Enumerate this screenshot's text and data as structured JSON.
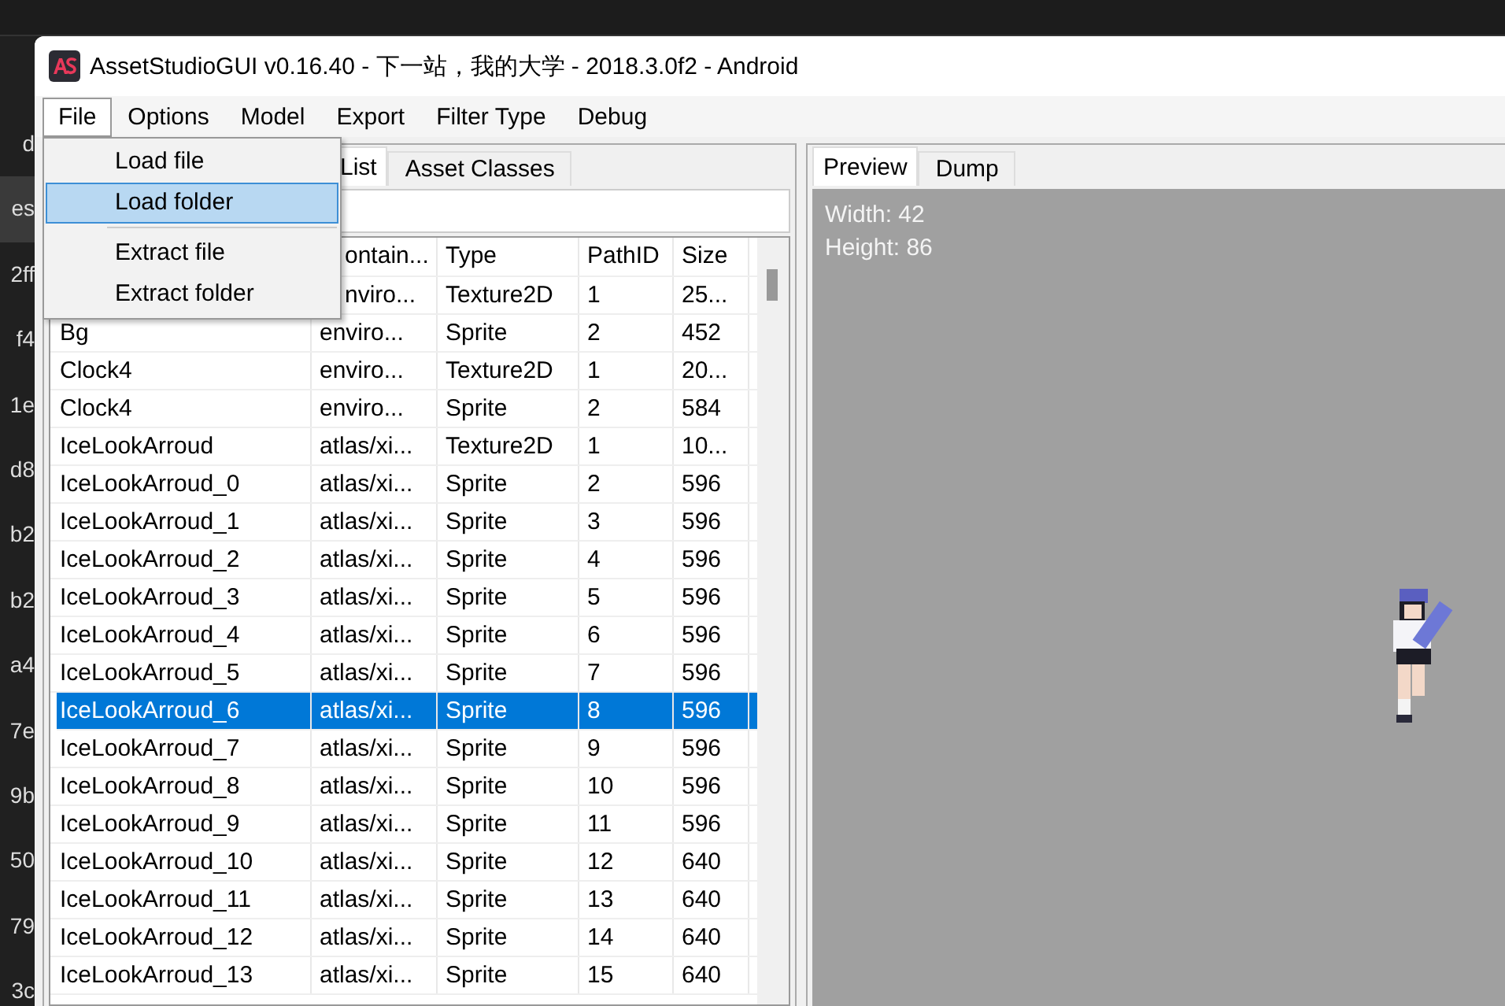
{
  "background_list": [
    {
      "text": "d",
      "selected": false
    },
    {
      "text": "es",
      "selected": true
    },
    {
      "text": "2ff",
      "selected": false
    },
    {
      "text": "f4",
      "selected": false
    },
    {
      "text": "1e",
      "selected": false
    },
    {
      "text": "d8",
      "selected": false
    },
    {
      "text": "b2",
      "selected": false
    },
    {
      "text": "b2",
      "selected": false
    },
    {
      "text": "a4",
      "selected": false
    },
    {
      "text": "7e",
      "selected": false
    },
    {
      "text": "9b",
      "selected": false
    },
    {
      "text": "50",
      "selected": false
    },
    {
      "text": "79",
      "selected": false
    },
    {
      "text": "3c",
      "selected": false
    }
  ],
  "window": {
    "title": "AssetStudioGUI v0.16.40 - 下一站，我的大学 - 2018.3.0f2 - Android"
  },
  "menu_bar": [
    {
      "label": "File",
      "selected": true
    },
    {
      "label": "Options",
      "selected": false
    },
    {
      "label": "Model",
      "selected": false
    },
    {
      "label": "Export",
      "selected": false
    },
    {
      "label": "Filter Type",
      "selected": false
    },
    {
      "label": "Debug",
      "selected": false
    }
  ],
  "file_menu": [
    {
      "kind": "item",
      "label": "Load file",
      "selected": false
    },
    {
      "kind": "item",
      "label": "Load folder",
      "selected": true
    },
    {
      "kind": "separator"
    },
    {
      "kind": "item",
      "label": "Extract file",
      "selected": false
    },
    {
      "kind": "item",
      "label": "Extract folder",
      "selected": false
    }
  ],
  "left_tabs": [
    {
      "label": "List",
      "selected": true
    },
    {
      "label": "Asset Classes",
      "selected": false
    }
  ],
  "table": {
    "columns": [
      "ontain...",
      "Type",
      "PathID",
      "Size"
    ],
    "rows": [
      {
        "name": "",
        "container": "nviro...",
        "type": "Texture2D",
        "path_id": "1",
        "size": "25...",
        "selected": false
      },
      {
        "name": "Bg",
        "container": "enviro...",
        "type": "Sprite",
        "path_id": "2",
        "size": "452",
        "selected": false
      },
      {
        "name": "Clock4",
        "container": "enviro...",
        "type": "Texture2D",
        "path_id": "1",
        "size": "20...",
        "selected": false
      },
      {
        "name": "Clock4",
        "container": "enviro...",
        "type": "Sprite",
        "path_id": "2",
        "size": "584",
        "selected": false
      },
      {
        "name": "IceLookArroud",
        "container": "atlas/xi...",
        "type": "Texture2D",
        "path_id": "1",
        "size": "10...",
        "selected": false
      },
      {
        "name": "IceLookArroud_0",
        "container": "atlas/xi...",
        "type": "Sprite",
        "path_id": "2",
        "size": "596",
        "selected": false
      },
      {
        "name": "IceLookArroud_1",
        "container": "atlas/xi...",
        "type": "Sprite",
        "path_id": "3",
        "size": "596",
        "selected": false
      },
      {
        "name": "IceLookArroud_2",
        "container": "atlas/xi...",
        "type": "Sprite",
        "path_id": "4",
        "size": "596",
        "selected": false
      },
      {
        "name": "IceLookArroud_3",
        "container": "atlas/xi...",
        "type": "Sprite",
        "path_id": "5",
        "size": "596",
        "selected": false
      },
      {
        "name": "IceLookArroud_4",
        "container": "atlas/xi...",
        "type": "Sprite",
        "path_id": "6",
        "size": "596",
        "selected": false
      },
      {
        "name": "IceLookArroud_5",
        "container": "atlas/xi...",
        "type": "Sprite",
        "path_id": "7",
        "size": "596",
        "selected": false
      },
      {
        "name": "IceLookArroud_6",
        "container": "atlas/xi...",
        "type": "Sprite",
        "path_id": "8",
        "size": "596",
        "selected": true
      },
      {
        "name": "IceLookArroud_7",
        "container": "atlas/xi...",
        "type": "Sprite",
        "path_id": "9",
        "size": "596",
        "selected": false
      },
      {
        "name": "IceLookArroud_8",
        "container": "atlas/xi...",
        "type": "Sprite",
        "path_id": "10",
        "size": "596",
        "selected": false
      },
      {
        "name": "IceLookArroud_9",
        "container": "atlas/xi...",
        "type": "Sprite",
        "path_id": "11",
        "size": "596",
        "selected": false
      },
      {
        "name": "IceLookArroud_10",
        "container": "atlas/xi...",
        "type": "Sprite",
        "path_id": "12",
        "size": "640",
        "selected": false
      },
      {
        "name": "IceLookArroud_11",
        "container": "atlas/xi...",
        "type": "Sprite",
        "path_id": "13",
        "size": "640",
        "selected": false
      },
      {
        "name": "IceLookArroud_12",
        "container": "atlas/xi...",
        "type": "Sprite",
        "path_id": "14",
        "size": "640",
        "selected": false
      },
      {
        "name": "IceLookArroud_13",
        "container": "atlas/xi...",
        "type": "Sprite",
        "path_id": "15",
        "size": "640",
        "selected": false
      }
    ]
  },
  "right_tabs": [
    {
      "label": "Preview",
      "selected": true
    },
    {
      "label": "Dump",
      "selected": false
    }
  ],
  "preview": {
    "width": "Width: 42",
    "height": "Height: 86"
  }
}
